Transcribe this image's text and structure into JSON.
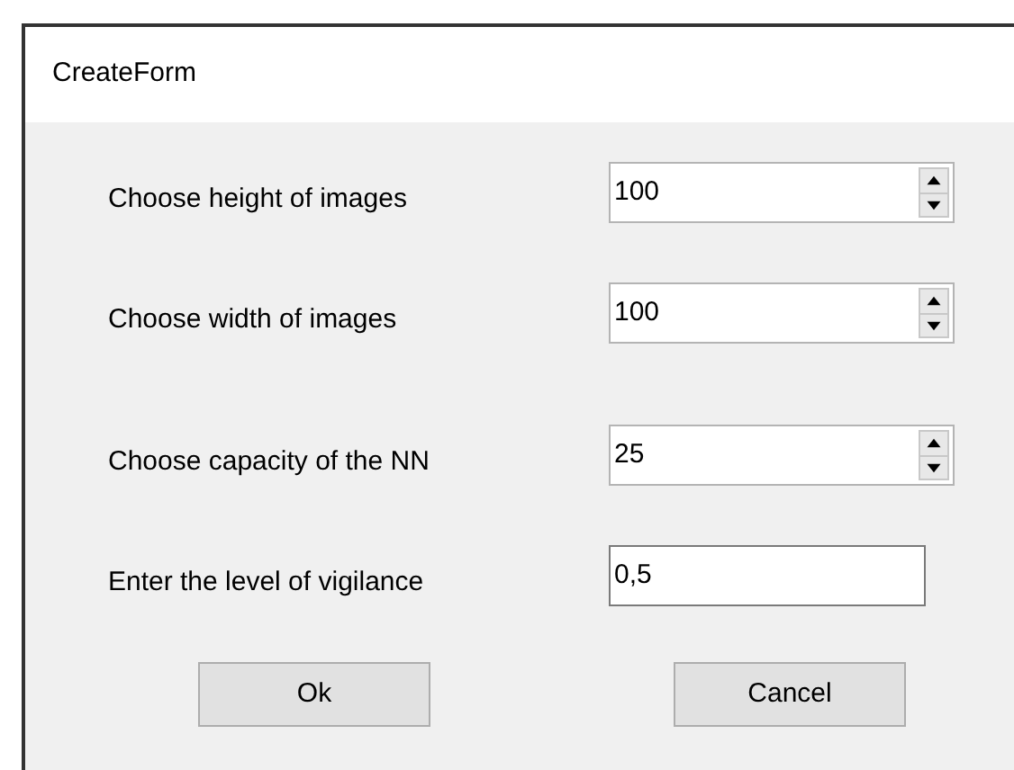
{
  "window": {
    "title": "CreateForm"
  },
  "fields": [
    {
      "label": "Choose height of images",
      "kind": "spinner",
      "value": "100"
    },
    {
      "label": "Choose width of images",
      "kind": "spinner",
      "value": "100"
    },
    {
      "label": "Choose capacity of the NN",
      "kind": "spinner",
      "value": "25"
    },
    {
      "label": "Enter the level of vigilance",
      "kind": "text",
      "value": "0,5"
    }
  ],
  "buttons": [
    "Ok",
    "Cancel"
  ]
}
